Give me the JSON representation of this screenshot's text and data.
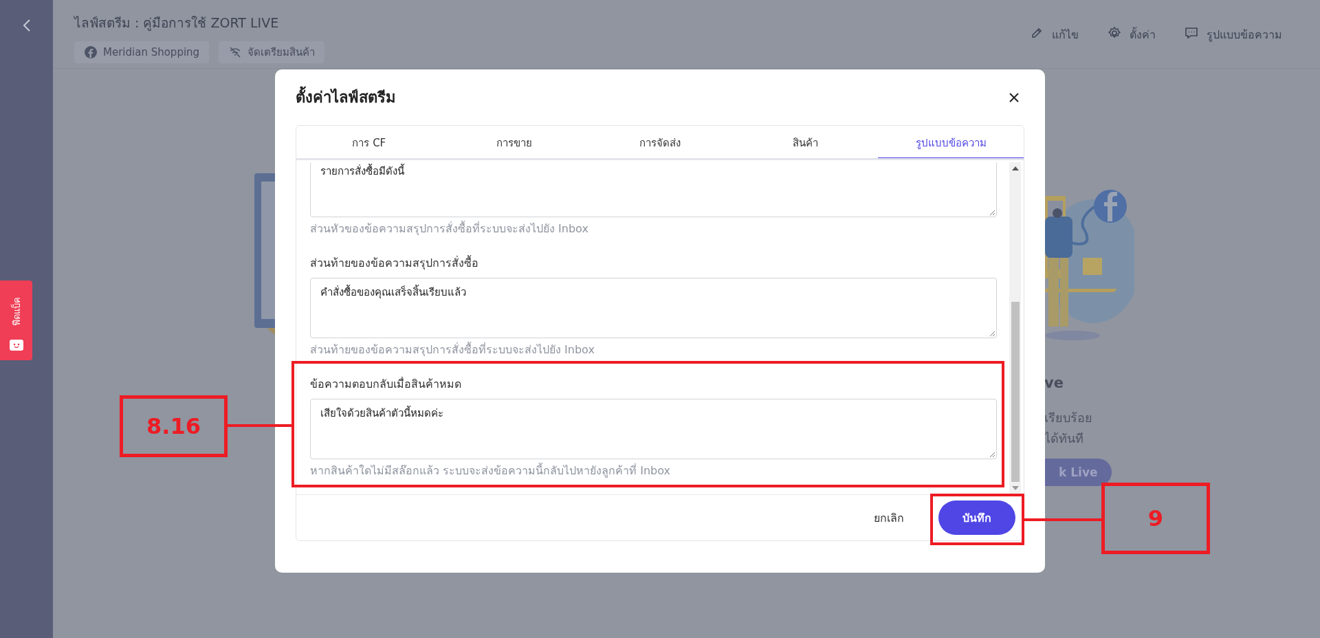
{
  "header": {
    "title": "ไลฟ์สตรีม : คู่มือการใช้ ZORT LIVE",
    "chips": [
      {
        "label": "Meridian Shopping",
        "kind": "facebook"
      },
      {
        "label": "จัดเตรียมสินค้า",
        "kind": "no-signal"
      }
    ],
    "actions": [
      {
        "label": "แก้ไข",
        "kind": "edit"
      },
      {
        "label": "ตั้งค่า",
        "kind": "settings"
      },
      {
        "label": "รูปแบบข้อความ",
        "kind": "message"
      }
    ]
  },
  "feedback_tab": {
    "label": "ฟีดแบ็ค"
  },
  "background_card": {
    "heading": "ve",
    "lines": [
      "เรียบร้อย",
      "ได้ทันที"
    ],
    "button": "k Live"
  },
  "dialog": {
    "title": "ตั้งค่าไลฟ์สตรีม",
    "tabs": [
      {
        "label": "การ CF",
        "selected": false
      },
      {
        "label": "การขาย",
        "selected": false
      },
      {
        "label": "การจัดส่ง",
        "selected": false
      },
      {
        "label": "สินค้า",
        "selected": false
      },
      {
        "label": "รูปแบบข้อความ",
        "selected": true
      }
    ],
    "fields": [
      {
        "value": "รายการสั่งซื้อมีดังนี้",
        "hint": "ส่วนหัวของข้อความสรุปการสั่งซื้อที่ระบบจะส่งไปยัง Inbox"
      },
      {
        "label": "ส่วนท้ายของข้อความสรุปการสั่งซื้อ",
        "value": "คำสั่งซื้อของคุณเสร็จสิ้นเรียบแล้ว",
        "hint": "ส่วนท้ายของข้อความสรุปการสั่งซื้อที่ระบบจะส่งไปยัง Inbox"
      },
      {
        "label": "ข้อความตอบกลับเมื่อสินค้าหมด",
        "value": "เสียใจด้วยสินค้าตัวนี้หมดค่ะ",
        "hint": "หากสินค้าใดไม่มีสล๊อกแล้ว ระบบจะส่งข้อความนี้กลับไปหายังลูกค้าที่ Inbox"
      }
    ],
    "cancel_button": "ยกเลิก",
    "save_button": "บันทึก"
  },
  "annotations": [
    {
      "label": "8.16"
    },
    {
      "label": "9"
    }
  ]
}
